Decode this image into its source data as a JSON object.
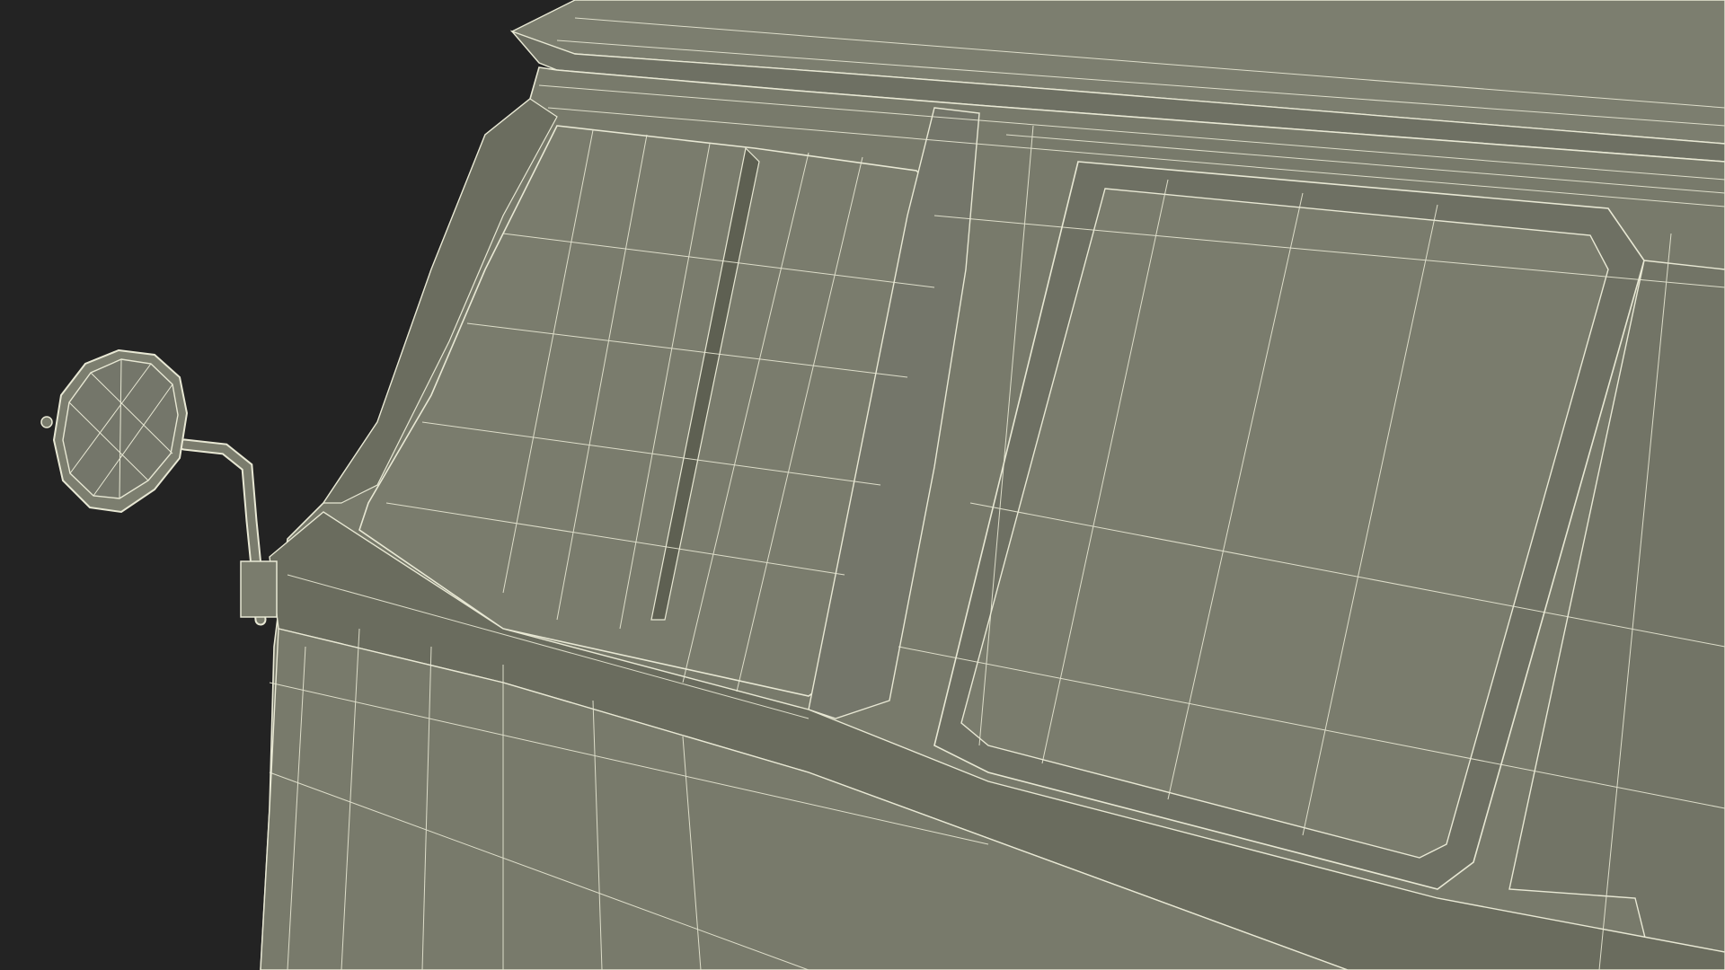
{
  "scene": {
    "subject": "van-side-wireframe-render",
    "background_color": "#232323",
    "body_color": "#787a6b",
    "body_shadow_color": "#5e6052",
    "wire_color": "#e8e8d4",
    "interior_panel_color": "#7a7c6d",
    "icons": [
      "side-mirror-icon"
    ]
  }
}
